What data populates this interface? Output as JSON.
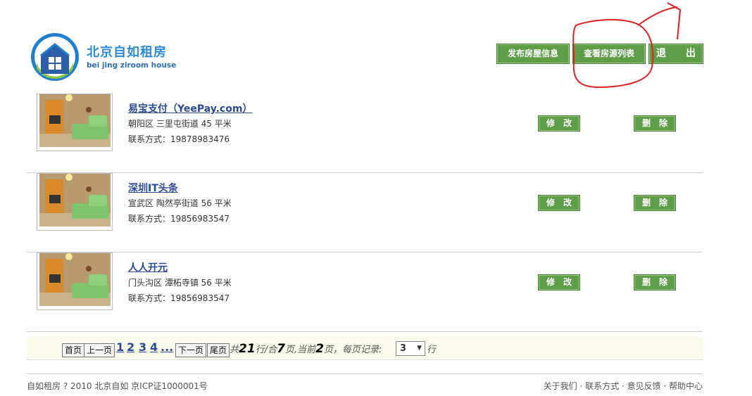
{
  "header": {
    "brand_cn": "北京自如租房",
    "brand_en": "bei jing ziroom house",
    "buttons": {
      "publish": "发布房屋信息",
      "list": "查看房源列表",
      "logout": "退　　出"
    }
  },
  "listings": [
    {
      "title": "易宝支付（YeePay.com）",
      "address": "朝阳区 三里屯街道 45 平米",
      "contact": "联系方式：19878983476",
      "edit": "修　改",
      "delete": "删　除"
    },
    {
      "title": "深圳IT头条",
      "address": "宣武区 陶然亭街道 56 平米",
      "contact": "联系方式：19856983547",
      "edit": "修　改",
      "delete": "删　除"
    },
    {
      "title": "人人开元",
      "address": "门头沟区 潭柘寺镇 56 平米",
      "contact": "联系方式：19856983547",
      "edit": "修　改",
      "delete": "删　除"
    }
  ],
  "pagination": {
    "first": "首页",
    "prev": "上一页",
    "pages": [
      "1",
      "2",
      "3",
      "4",
      "..."
    ],
    "next": "下一页",
    "last": "尾页",
    "total_prefix": "共",
    "total": "21",
    "total_suffix": "行/合",
    "page_count": "7",
    "page_count_suffix": "页,当前",
    "current": "2",
    "current_suffix": "页，每页记录:",
    "per_page": "3",
    "per_page_suffix": "行"
  },
  "footer": {
    "copyright": "自如租房 ? 2010 北京自如 京ICP证1000001号",
    "links": "关于我们 · 联系方式 · 意见反馈 · 帮助中心"
  },
  "colors": {
    "button_green": "#5f9e48",
    "brand_blue": "#2f8ad6",
    "annotation_red": "#e02020"
  }
}
